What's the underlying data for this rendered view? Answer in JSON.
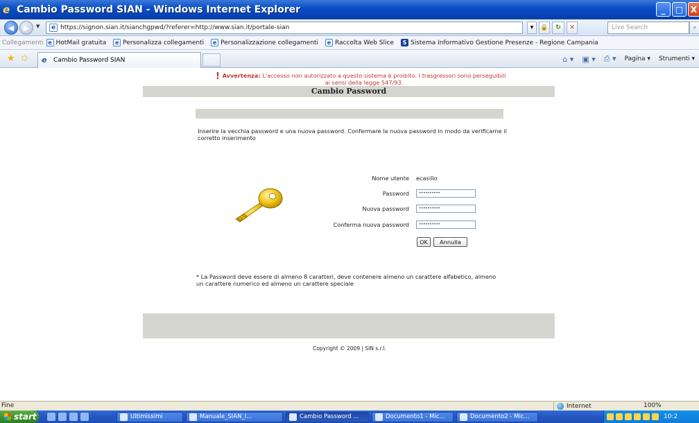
{
  "window": {
    "title": "Cambio Password SIAN - Windows Internet Explorer",
    "btn_min": "_",
    "btn_max": "□",
    "btn_close": "X"
  },
  "addressbar": {
    "url": "https://signon.sian.it/sianchgpwd/?referer=http://www.sian.it/portale-sian",
    "search_placeholder": "Live Search"
  },
  "linksbar": {
    "label": "Collegamenti",
    "items": [
      "HotMail gratuita",
      "Personalizza collegamenti",
      "Personalizzazione collegamenti",
      "Raccolta Web Slice",
      "Sistema Informativo Gestione Presenze - Regione Campania"
    ]
  },
  "tabbar": {
    "tab_title": "Cambio Password SIAN",
    "commands": [
      "Pagina ▾",
      "Strumenti ▾"
    ]
  },
  "page": {
    "header": "Cambio Password",
    "instructions": "Inserire la vecchia password e una nuova password. Confermare la nuova password in modo da verificarne il corretto inserimento",
    "username_label": "Nome utente",
    "username_value": "ecasillo",
    "password_label": "Password",
    "password_value": "••••••••••",
    "new_password_label": "Nuova password",
    "new_password_value": "••••••••••",
    "confirm_password_label": "Conferma nuova password",
    "confirm_password_value": "••••••••••",
    "ok_label": "OK",
    "cancel_label": "Annulla",
    "note": "* La Password deve essere di almeno 8 caratteri, deve contenere almeno un carattere alfabetico, almeno un carattere numerico ed almeno un carattere speciale",
    "warning_title": "Avvertenza:",
    "warning_text": "L'accesso non autorizzato a questo sistema è proibito. I trasgressori sono perseguibili ai sensi della legge 547/93.",
    "copyright": "Copyright © 2009 | SIN s.r.l."
  },
  "statusbar": {
    "status": "Fine",
    "zone": "Internet",
    "zoom": "100%"
  },
  "taskbar": {
    "start": "start",
    "buttons": [
      "Ultimissimi",
      "Manuale_SIAN_I...",
      "Cambio Password ...",
      "Documento1 - Mic...",
      "Documento2 - Mic..."
    ],
    "clock": "10:2"
  }
}
